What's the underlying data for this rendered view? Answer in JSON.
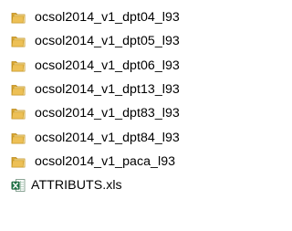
{
  "files": [
    {
      "name": "ocsol2014_v1_dpt04_l93",
      "type": "folder",
      "icon": "folder-icon"
    },
    {
      "name": "ocsol2014_v1_dpt05_l93",
      "type": "folder",
      "icon": "folder-icon"
    },
    {
      "name": "ocsol2014_v1_dpt06_l93",
      "type": "folder",
      "icon": "folder-icon"
    },
    {
      "name": "ocsol2014_v1_dpt13_l93",
      "type": "folder",
      "icon": "folder-icon"
    },
    {
      "name": "ocsol2014_v1_dpt83_l93",
      "type": "folder",
      "icon": "folder-icon"
    },
    {
      "name": "ocsol2014_v1_dpt84_l93",
      "type": "folder",
      "icon": "folder-icon"
    },
    {
      "name": "ocsol2014_v1_paca_l93",
      "type": "folder",
      "icon": "folder-icon"
    },
    {
      "name": "ATTRIBUTS.xls",
      "type": "excel-file",
      "icon": "excel-file-icon"
    }
  ],
  "colors": {
    "folder_body": "#e7b94c",
    "folder_front": "#f5d67a",
    "excel_green": "#1e7145",
    "text": "#000000",
    "background": "#ffffff"
  }
}
